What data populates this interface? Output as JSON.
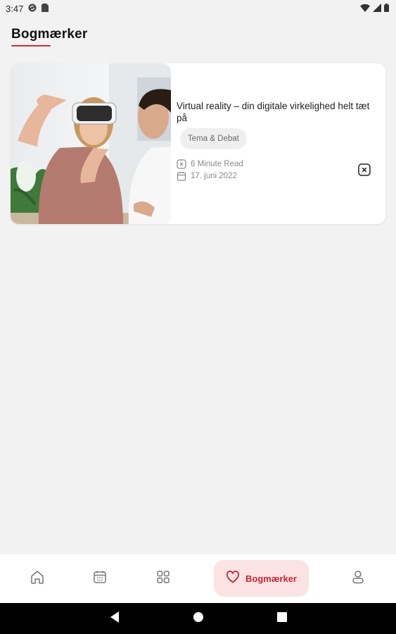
{
  "status_bar": {
    "time": "3:47",
    "icons": [
      "sync-icon",
      "sim-card-icon",
      "wifi-icon",
      "signal-icon",
      "battery-icon"
    ]
  },
  "page": {
    "title": "Bogmærker",
    "accent_color": "#d62b38"
  },
  "bookmarks": [
    {
      "title": "Virtual reality – din digitale virkelighed helt tæt på",
      "category": "Tema & Debat",
      "read_time": "6 Minute Read",
      "date": "17. juni 2022",
      "image_description_icon": "photo-vr-headset"
    }
  ],
  "bottom_nav": {
    "items": [
      {
        "icon": "home-icon",
        "label": ""
      },
      {
        "icon": "calendar-icon",
        "label": ""
      },
      {
        "icon": "grid-icon",
        "label": ""
      },
      {
        "icon": "heart-icon",
        "label": "Bogmærker",
        "active": true
      },
      {
        "icon": "profile-icon",
        "label": ""
      }
    ],
    "active_color": "#c9252f",
    "active_bg": "#fbe3e4"
  },
  "system_nav": {
    "icons": [
      "back-icon",
      "home-circle-icon",
      "recents-icon"
    ]
  }
}
